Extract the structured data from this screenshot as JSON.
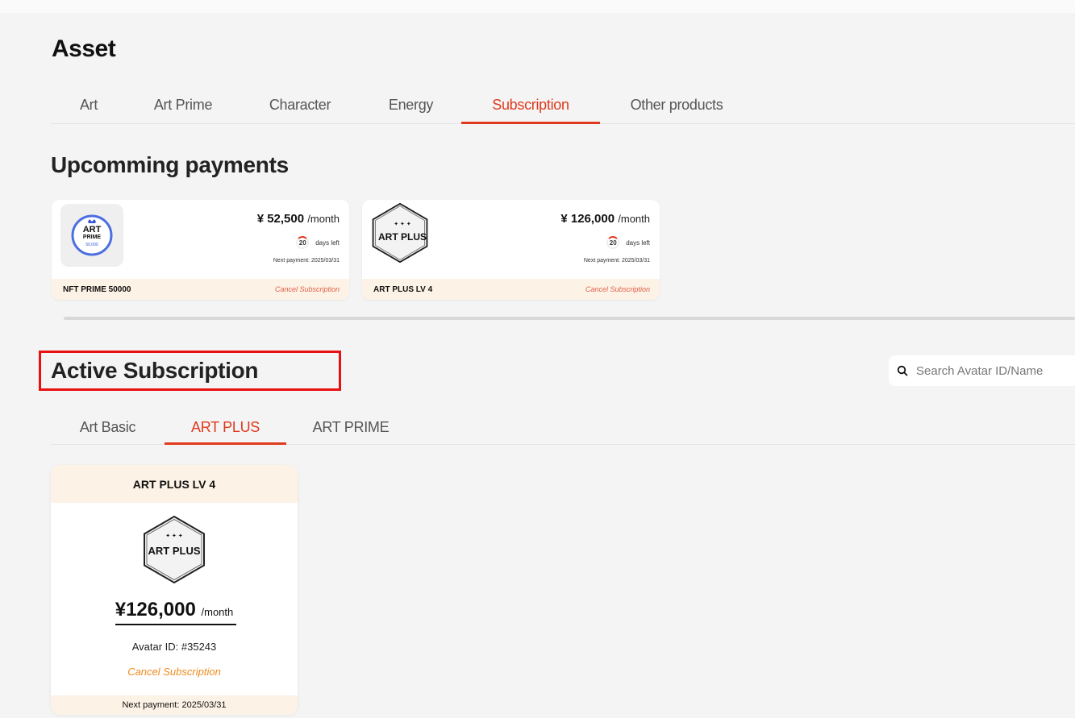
{
  "page": {
    "title": "Asset"
  },
  "main_tabs": [
    {
      "label": "Art"
    },
    {
      "label": "Art Prime"
    },
    {
      "label": "Character"
    },
    {
      "label": "Energy"
    },
    {
      "label": "Subscription",
      "active": true
    },
    {
      "label": "Other products"
    }
  ],
  "upcoming": {
    "title": "Upcomming payments",
    "cards": [
      {
        "logo_text": "ART",
        "logo_sub": "PRIME",
        "logo_num": "50,000",
        "price": "¥ 52,500",
        "per": "/month",
        "days": "20",
        "days_label": "days left",
        "next": "Next payment: 2025/03/31",
        "name": "NFT PRIME 50000",
        "cancel": "Cancel Subscription"
      },
      {
        "logo_text": "ART PLUS",
        "logo_stars": "✦ ✦ ✦",
        "price": "¥ 126,000",
        "per": "/month",
        "days": "20",
        "days_label": "days left",
        "next": "Next payment: 2025/03/31",
        "name": "ART PLUS LV 4",
        "cancel": "Cancel Subscription"
      }
    ]
  },
  "active": {
    "title": "Active Subscription",
    "search_placeholder": "Search Avatar ID/Name",
    "tabs": [
      {
        "label": "Art Basic"
      },
      {
        "label": "ART PLUS",
        "active": true
      },
      {
        "label": "ART PRIME"
      }
    ],
    "card": {
      "name": "ART PLUS LV 4",
      "logo_text": "ART PLUS",
      "logo_stars": "✦ ✦ ✦",
      "price": "¥126,000",
      "per": "/month",
      "avatar_id": "Avatar ID: #35243",
      "cancel": "Cancel Subscription",
      "next": "Next payment: 2025/03/31"
    }
  },
  "colors": {
    "accent": "#e03a1e",
    "highlight": "#e81010",
    "card_footer": "#fdf2e6",
    "cancel_orange": "#f08a1c"
  }
}
